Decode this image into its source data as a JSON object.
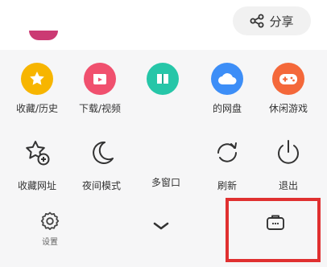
{
  "header": {
    "share_label": "分享"
  },
  "row1": [
    {
      "label": "收藏/历史",
      "icon": "star-icon",
      "color": "#f7b500"
    },
    {
      "label": "下载/视频",
      "icon": "download-video-icon",
      "color": "#f0506e"
    },
    {
      "label": "",
      "icon": "book-icon",
      "color": "#26c6a8"
    },
    {
      "label": "的网盘",
      "icon": "cloud-icon",
      "color": "#3d8ef7"
    },
    {
      "label": "休闲游戏",
      "icon": "gamepad-icon",
      "color": "#f4683a"
    }
  ],
  "row2": [
    {
      "label": "收藏网址",
      "icon": "star-add-icon"
    },
    {
      "label": "夜间模式",
      "icon": "moon-icon"
    },
    {
      "label": "多窗口",
      "icon": ""
    },
    {
      "label": "刷新",
      "icon": "refresh-icon"
    },
    {
      "label": "退出",
      "icon": "power-icon"
    }
  ],
  "bottom": {
    "settings_label": "设置",
    "collapse_icon": "chevron-down-icon",
    "toolbox_icon": "toolbox-icon"
  },
  "colors": {
    "highlight": "#e03030",
    "panel_bg": "#f6f6f7"
  }
}
